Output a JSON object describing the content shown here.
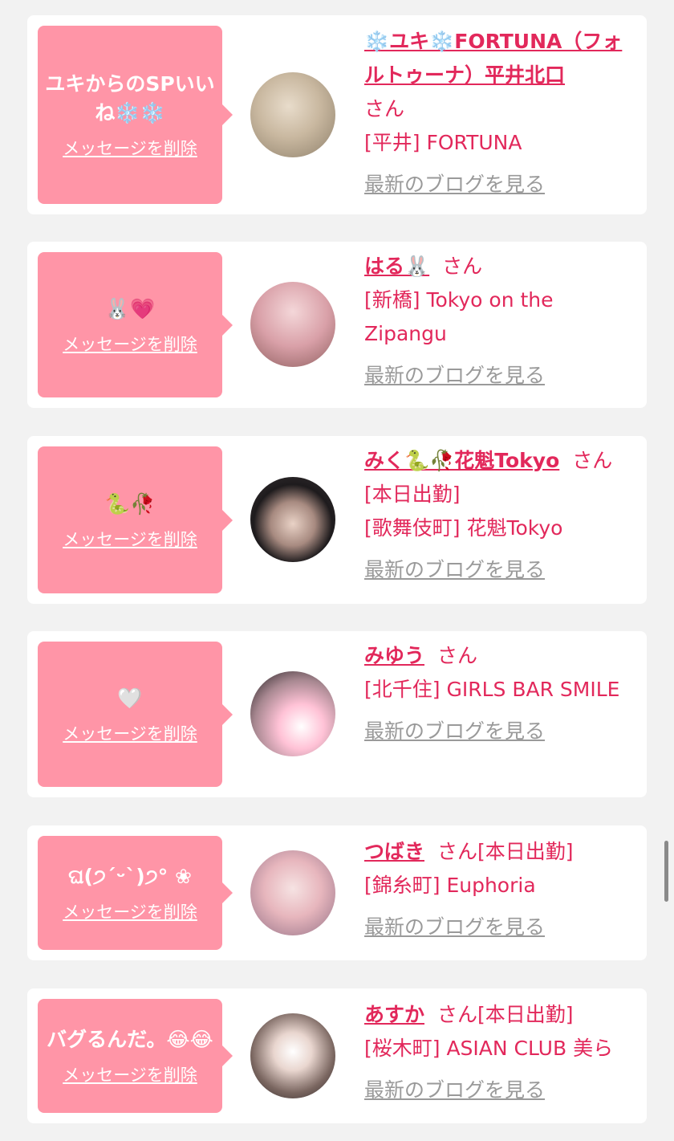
{
  "cards": [
    {
      "message": "ユキからのSPいいね❄️❄️",
      "delete_label": "メッセージを削除",
      "name": "❄️ユキ❄️FORTUNA（フォルトゥーナ）平井北口",
      "suffix": "さん",
      "status": "",
      "shop": "[平井] FORTUNA",
      "blog_label": "最新のブログを見る"
    },
    {
      "message": "🐰💗",
      "delete_label": "メッセージを削除",
      "name": "はる🐰",
      "suffix": "さん",
      "status": "",
      "shop": "[新橋] Tokyo on the Zipangu",
      "blog_label": "最新のブログを見る"
    },
    {
      "message": "🐍🥀",
      "delete_label": "メッセージを削除",
      "name": "みく🐍🥀花魁Tokyo",
      "suffix": "さん",
      "status": "[本日出勤]",
      "shop": "[歌舞伎町] 花魁Tokyo",
      "blog_label": "最新のブログを見る"
    },
    {
      "message": "🤍",
      "delete_label": "メッセージを削除",
      "name": "みゆう",
      "suffix": "さん",
      "status": "",
      "shop": "[北千住] GIRLS BAR SMILE",
      "blog_label": "最新のブログを見る"
    },
    {
      "message": "ଘ(੭ˊᵕˋ)੭° ❀",
      "delete_label": "メッセージを削除",
      "name": "つばき",
      "suffix": "さん",
      "status": "[本日出勤]",
      "shop": "[錦糸町] Euphoria",
      "blog_label": "最新のブログを見る"
    },
    {
      "message": "バグるんだ。😂😂",
      "delete_label": "メッセージを削除",
      "name": "あすか",
      "suffix": "さん",
      "status": "[本日出勤]",
      "shop": "[桜木町] ASIAN CLUB 美ら",
      "blog_label": "最新のブログを見る"
    }
  ],
  "colors": {
    "background": "#f2f2f2",
    "bubble": "#ff95a7",
    "accent": "#e2285b",
    "muted": "#9a9a9a"
  }
}
